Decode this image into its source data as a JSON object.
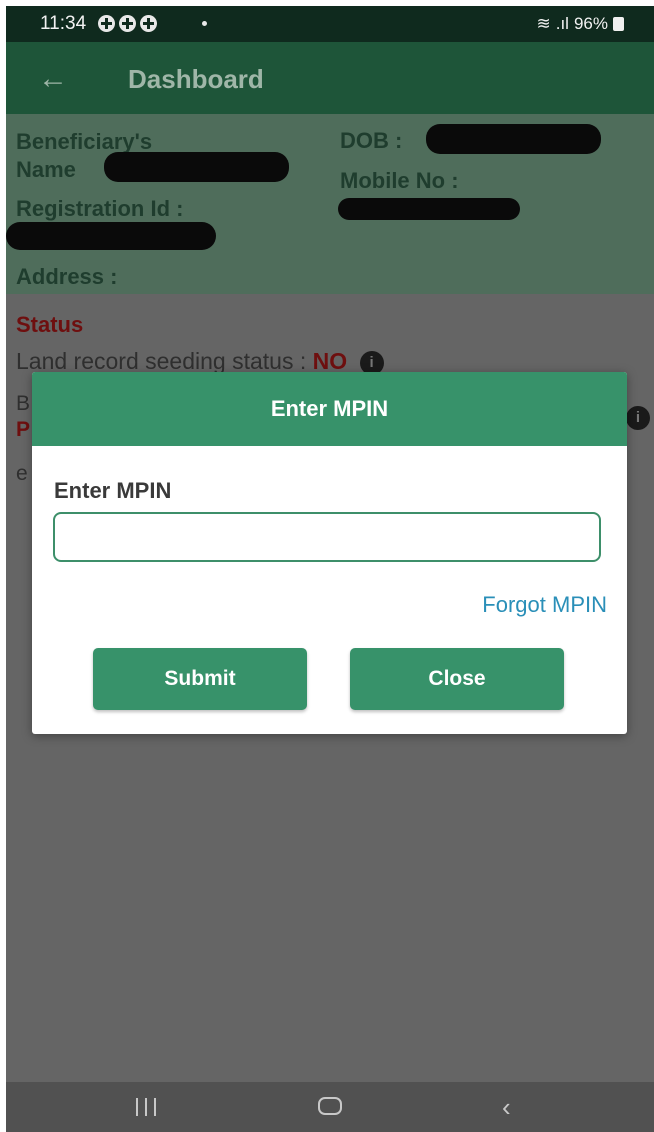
{
  "status_bar": {
    "time": "11:34",
    "battery": "96%",
    "notification_icons": [
      "notification-icon",
      "notification-icon",
      "notification-icon"
    ]
  },
  "app_bar": {
    "back_icon": "arrow-left-icon",
    "title": "Dashboard"
  },
  "beneficiary": {
    "name_label": "Beneficiary's Name",
    "dob_label": "DOB :",
    "mobile_label": "Mobile No :",
    "registration_label": "Registration Id :",
    "address_label": "Address :"
  },
  "status_section": {
    "heading": "Status",
    "land_record_label": "Land record seeding status :",
    "land_record_value": "NO",
    "info_icon": "info-icon"
  },
  "dialog": {
    "title": "Enter MPIN",
    "field_label": "Enter MPIN",
    "input_value": "",
    "forgot_link": "Forgot MPIN",
    "submit_label": "Submit",
    "close_label": "Close"
  },
  "colors": {
    "primary_green": "#37926a",
    "app_bar_green": "#1e5539",
    "link_blue": "#2a8fb8",
    "status_red": "#6e0f0f"
  }
}
